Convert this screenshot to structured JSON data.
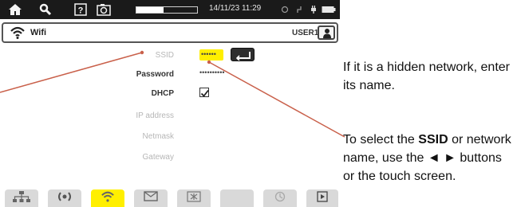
{
  "status_bar": {
    "datetime": "14/11/23 11:29",
    "memory_fill": 0.45,
    "icons": [
      "home-icon",
      "wrench-icon",
      "help-icon",
      "camera-icon",
      "battery-icon"
    ]
  },
  "title_bar": {
    "title": "Wifi",
    "user": "USER1"
  },
  "form": {
    "fields": [
      {
        "label": "SSID",
        "style": "dim"
      },
      {
        "label": "Password",
        "style": "dark"
      },
      {
        "label": "DHCP",
        "style": "dark"
      },
      {
        "label": "IP address",
        "style": "dim"
      },
      {
        "label": "Netmask",
        "style": "dim"
      },
      {
        "label": "Gateway",
        "style": "dim"
      }
    ],
    "ssid_value": "••••••",
    "password_value": "••••••••••",
    "dhcp_checked": true
  },
  "tabs": [
    {
      "icon": "ethernet-icon",
      "active": false
    },
    {
      "icon": "bluetooth-icon",
      "active": false
    },
    {
      "icon": "wifi-icon",
      "active": true
    },
    {
      "icon": "email-icon",
      "active": false
    },
    {
      "icon": "server-icon",
      "active": false
    },
    {
      "icon": "blank-icon",
      "active": false
    },
    {
      "icon": "refresh-icon",
      "active": false
    },
    {
      "icon": "play-icon",
      "active": false
    }
  ],
  "annotations": {
    "hidden_network": "If it is a hidden network, enter its name.",
    "ssid_prefix": "To select the ",
    "ssid_bold_1": "SSID",
    "ssid_middle": " or network name, use the ◄ ► buttons or the touch screen."
  },
  "colors": {
    "highlight": "#ffef00",
    "callout_line": "#c9604a",
    "status_bar": "#1a1a1a"
  }
}
